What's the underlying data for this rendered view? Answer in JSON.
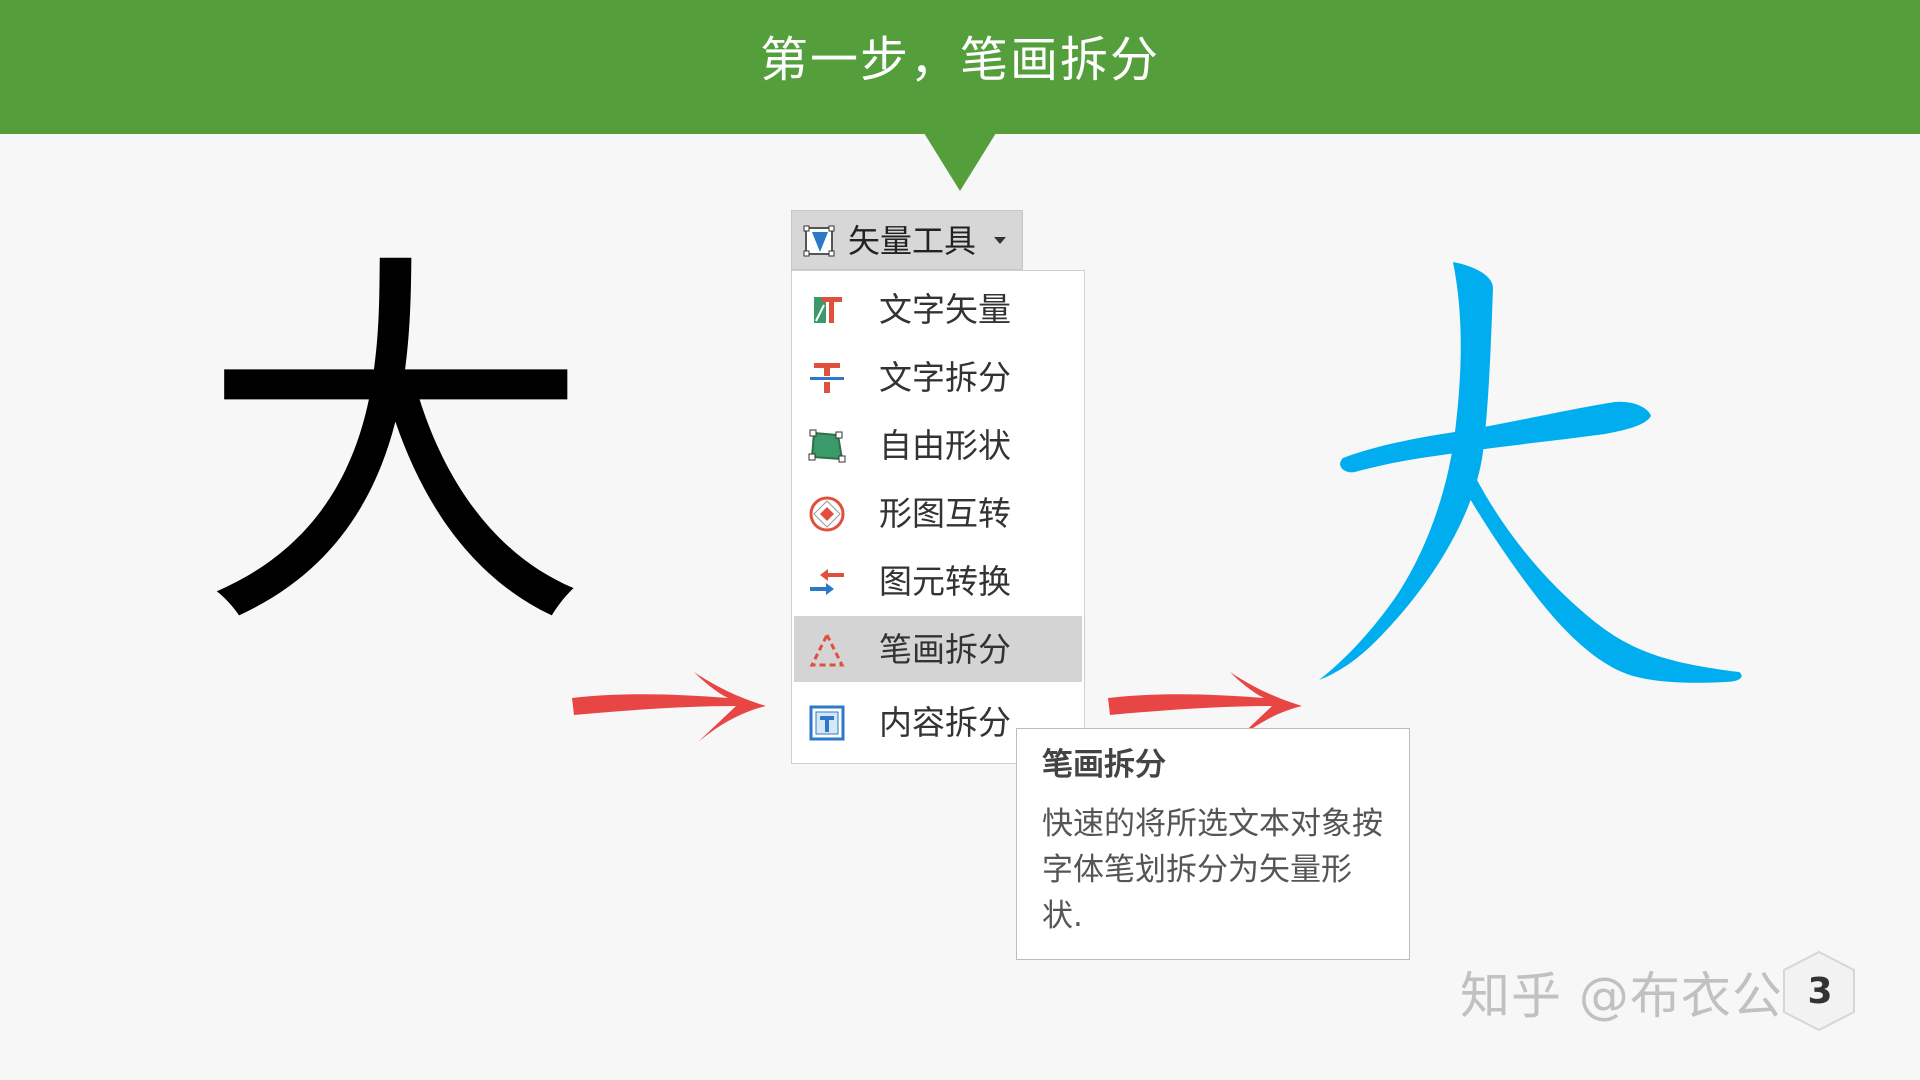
{
  "header": {
    "title": "第一步，笔画拆分",
    "color": "#549e3c"
  },
  "left_character": "大",
  "vector_tools": {
    "label": "矢量工具",
    "icon": "vector-tools-icon"
  },
  "menu": {
    "items": [
      {
        "label": "文字矢量",
        "icon": "text-vector-icon"
      },
      {
        "label": "文字拆分",
        "icon": "text-split-icon"
      },
      {
        "label": "自由形状",
        "icon": "free-shape-icon"
      },
      {
        "label": "形图互转",
        "icon": "shape-convert-icon"
      },
      {
        "label": "图元转换",
        "icon": "element-convert-icon"
      },
      {
        "label": "笔画拆分",
        "icon": "stroke-split-icon",
        "selected": true
      },
      {
        "label": "内容拆分",
        "icon": "content-split-icon"
      }
    ]
  },
  "tooltip": {
    "title": "笔画拆分",
    "description": "快速的将所选文本对象按字体笔划拆分为矢量形状."
  },
  "right_character_color": "#00aeef",
  "arrow_color": "#e84545",
  "watermark": "知乎 @布衣公子",
  "page_number": "3"
}
